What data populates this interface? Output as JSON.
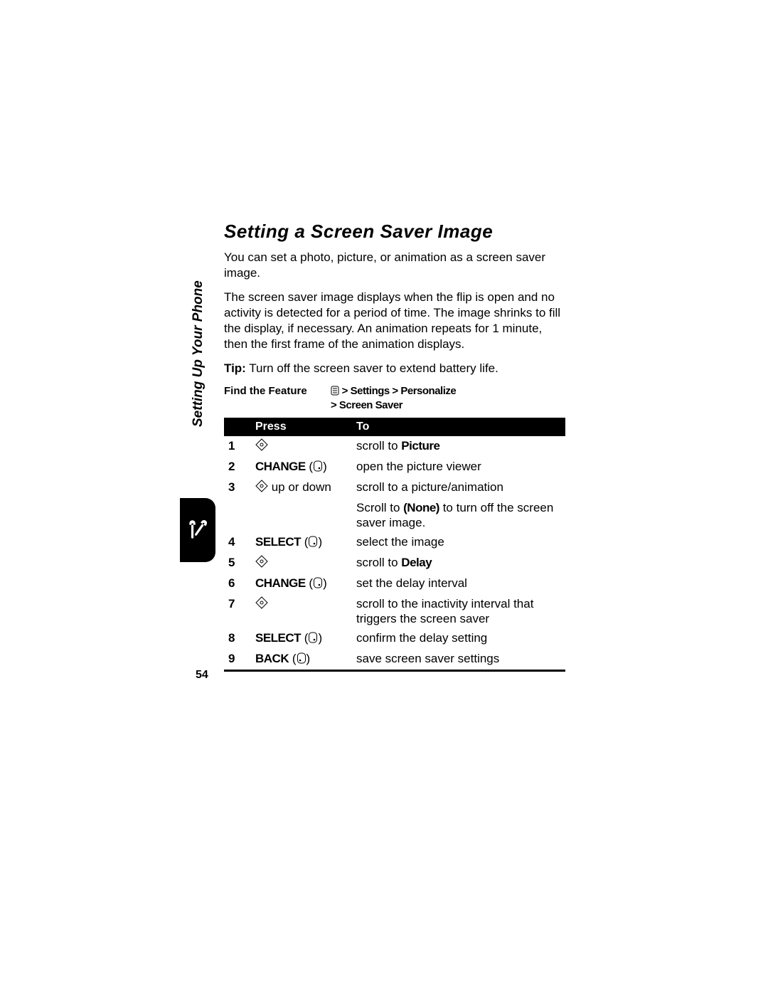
{
  "side_label": "Setting Up Your Phone",
  "heading": "Setting a Screen Saver Image",
  "para1": "You can set a photo, picture, or animation as a screen saver image.",
  "para2": "The screen saver image displays when the flip is open and no activity is detected for a period of time. The image shrinks to fill the display, if necessary. An animation repeats for 1 minute, then the first frame of the animation displays.",
  "tip_label": "Tip:",
  "tip_text": " Turn off the screen saver to extend battery life.",
  "ftf_label": "Find the Feature",
  "ftf_path_1": " > Settings > Personalize",
  "ftf_path_2": "> Screen Saver",
  "table": {
    "head_press": "Press",
    "head_to": "To",
    "rows": [
      {
        "n": "1",
        "action_key": "",
        "action_glyph": "nav",
        "action_suffix": "",
        "desc_pre": "scroll to ",
        "desc_bold": "Picture",
        "desc_post": ""
      },
      {
        "n": "2",
        "action_key": "CHANGE",
        "action_glyph": "soft",
        "action_suffix": "",
        "desc_pre": "open the picture viewer",
        "desc_bold": "",
        "desc_post": ""
      },
      {
        "n": "3",
        "action_key": "",
        "action_glyph": "nav",
        "action_suffix": " up or down",
        "desc_pre": "scroll to a picture/animation",
        "desc_bold": "",
        "desc_post": ""
      },
      {
        "n": "",
        "action_key": "",
        "action_glyph": "",
        "action_suffix": "",
        "desc_pre": "Scroll to ",
        "desc_bold": "(None)",
        "desc_post": " to turn off the screen saver image."
      },
      {
        "n": "4",
        "action_key": "SELECT",
        "action_glyph": "soft",
        "action_suffix": "",
        "desc_pre": "select the image",
        "desc_bold": "",
        "desc_post": ""
      },
      {
        "n": "5",
        "action_key": "",
        "action_glyph": "nav",
        "action_suffix": "",
        "desc_pre": "scroll to ",
        "desc_bold": "Delay",
        "desc_post": ""
      },
      {
        "n": "6",
        "action_key": "CHANGE",
        "action_glyph": "soft",
        "action_suffix": "",
        "desc_pre": "set the delay interval",
        "desc_bold": "",
        "desc_post": ""
      },
      {
        "n": "7",
        "action_key": "",
        "action_glyph": "nav",
        "action_suffix": "",
        "desc_pre": "scroll to the inactivity interval that triggers the screen saver",
        "desc_bold": "",
        "desc_post": ""
      },
      {
        "n": "8",
        "action_key": "SELECT",
        "action_glyph": "soft",
        "action_suffix": "",
        "desc_pre": "confirm the delay setting",
        "desc_bold": "",
        "desc_post": ""
      },
      {
        "n": "9",
        "action_key": "BACK",
        "action_glyph": "soft-left",
        "action_suffix": "",
        "desc_pre": "save screen saver settings",
        "desc_bold": "",
        "desc_post": ""
      }
    ]
  },
  "page_number": "54"
}
